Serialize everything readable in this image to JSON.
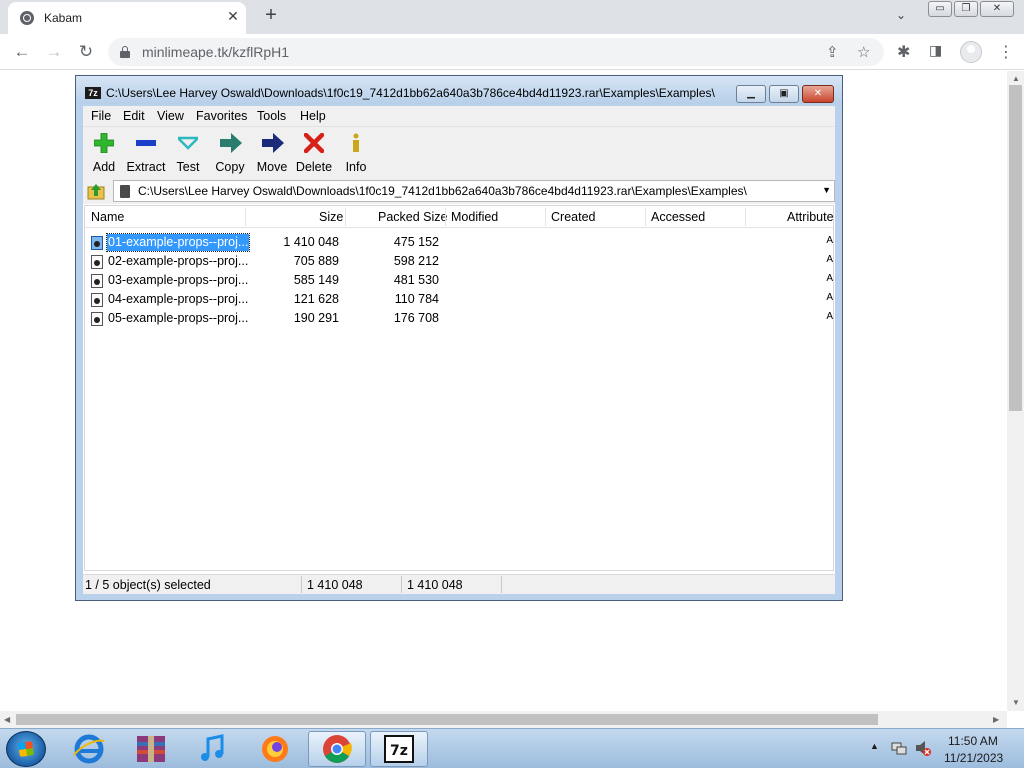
{
  "browser": {
    "tab_title": "Kabam",
    "tab_close": "✕",
    "new_tab": "+",
    "tab_dropdown": "⌄",
    "url": "minlimeape.tk/kzflRpH1",
    "window_controls": [
      "▭",
      "❐",
      "✕"
    ],
    "nav": {
      "back": "←",
      "forward": "→",
      "reload": "↻"
    },
    "toolbar_icons": [
      "share-icon",
      "star-icon",
      "extensions-icon",
      "sidepanel-icon",
      "profile-icon",
      "menu-icon"
    ]
  },
  "zip": {
    "title": "C:\\Users\\Lee Harvey Oswald\\Downloads\\1f0c19_7412d1bb62a640a3b786ce4bd4d11923.rar\\Examples\\Examples\\",
    "app_icon_text": "7z",
    "menu": [
      "File",
      "Edit",
      "View",
      "Favorites",
      "Tools",
      "Help"
    ],
    "toolbar": [
      {
        "label": "Add",
        "icon": "add-icon",
        "color": "#2eb82e"
      },
      {
        "label": "Extract",
        "icon": "extract-icon",
        "color": "#1a3fc9"
      },
      {
        "label": "Test",
        "icon": "test-icon",
        "color": "#2bb8c0"
      },
      {
        "label": "Copy",
        "icon": "copy-icon",
        "color": "#2a7d6e"
      },
      {
        "label": "Move",
        "icon": "move-icon",
        "color": "#1b2b7a"
      },
      {
        "label": "Delete",
        "icon": "delete-icon",
        "color": "#d8201a"
      },
      {
        "label": "Info",
        "icon": "info-icon",
        "color": "#caa81b"
      }
    ],
    "address": "C:\\Users\\Lee Harvey Oswald\\Downloads\\1f0c19_7412d1bb62a640a3b786ce4bd4d11923.rar\\Examples\\Examples\\",
    "columns": [
      "Name",
      "Size",
      "Packed Size",
      "Modified",
      "Created",
      "Accessed",
      "Attribute"
    ],
    "rows": [
      {
        "name": "01-example-props--proj...",
        "size": "1 410 048",
        "packed": "475 152",
        "attr": "A",
        "selected": true
      },
      {
        "name": "02-example-props--proj...",
        "size": "705 889",
        "packed": "598 212",
        "attr": "A",
        "selected": false
      },
      {
        "name": "03-example-props--proj...",
        "size": "585 149",
        "packed": "481 530",
        "attr": "A",
        "selected": false
      },
      {
        "name": "04-example-props--proj...",
        "size": "121 628",
        "packed": "110 784",
        "attr": "A",
        "selected": false
      },
      {
        "name": "05-example-props--proj...",
        "size": "190 291",
        "packed": "176 708",
        "attr": "A",
        "selected": false
      }
    ],
    "status": {
      "selection": "1 / 5 object(s) selected",
      "size": "1 410 048",
      "packed": "1 410 048"
    }
  },
  "taskbar": {
    "apps": [
      "internet-explorer-icon",
      "winrar-icon",
      "itunes-icon",
      "firefox-icon",
      "chrome-icon",
      "7zip-icon"
    ],
    "time": "11:50 AM",
    "date": "11/21/2023"
  }
}
